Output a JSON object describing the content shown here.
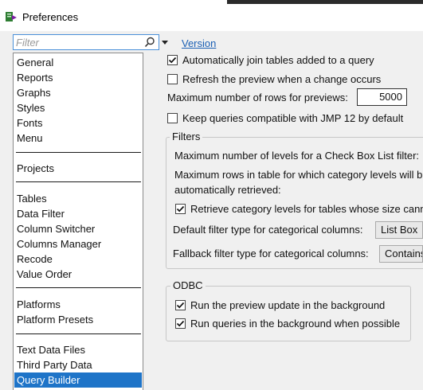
{
  "window": {
    "title": "Preferences"
  },
  "filter": {
    "placeholder": "Filter",
    "value": ""
  },
  "version_link": "Version",
  "categories": {
    "group1": [
      "General",
      "Reports",
      "Graphs",
      "Styles",
      "Fonts",
      "Menu"
    ],
    "group2": [
      "Projects"
    ],
    "group3": [
      "Tables",
      "Data Filter",
      "Column Switcher",
      "Columns Manager",
      "Recode",
      "Value Order"
    ],
    "group4": [
      "Platforms",
      "Platform Presets"
    ],
    "group5": [
      "Text Data Files",
      "Third Party Data",
      "Query Builder"
    ],
    "selected": "Query Builder"
  },
  "options": {
    "auto_join": {
      "label": "Automatically join tables added to a query",
      "checked": true
    },
    "refresh_preview": {
      "label": "Refresh the preview when a change occurs",
      "checked": false
    },
    "max_rows_label": "Maximum number of rows for previews:",
    "max_rows_value": "5000",
    "jmp12": {
      "label": "Keep queries compatible with JMP 12 by default",
      "checked": false
    }
  },
  "filters_group": {
    "title": "Filters",
    "max_levels_label": "Maximum number of levels for a Check Box List filter:",
    "max_rows_line1": "Maximum rows in table for which category levels will b",
    "max_rows_line2": "automatically retrieved:",
    "retrieve": {
      "label": "Retrieve category levels for tables whose size canno",
      "checked": true
    },
    "default_type_label": "Default filter type for categorical columns:",
    "default_type_value": "List Box",
    "fallback_type_label": "Fallback filter type for categorical columns:",
    "fallback_type_value": "Contains"
  },
  "odbc_group": {
    "title": "ODBC",
    "preview_bg": {
      "label": "Run the preview update in the background",
      "checked": true
    },
    "queries_bg": {
      "label": "Run queries in the background when possible",
      "checked": true
    }
  }
}
